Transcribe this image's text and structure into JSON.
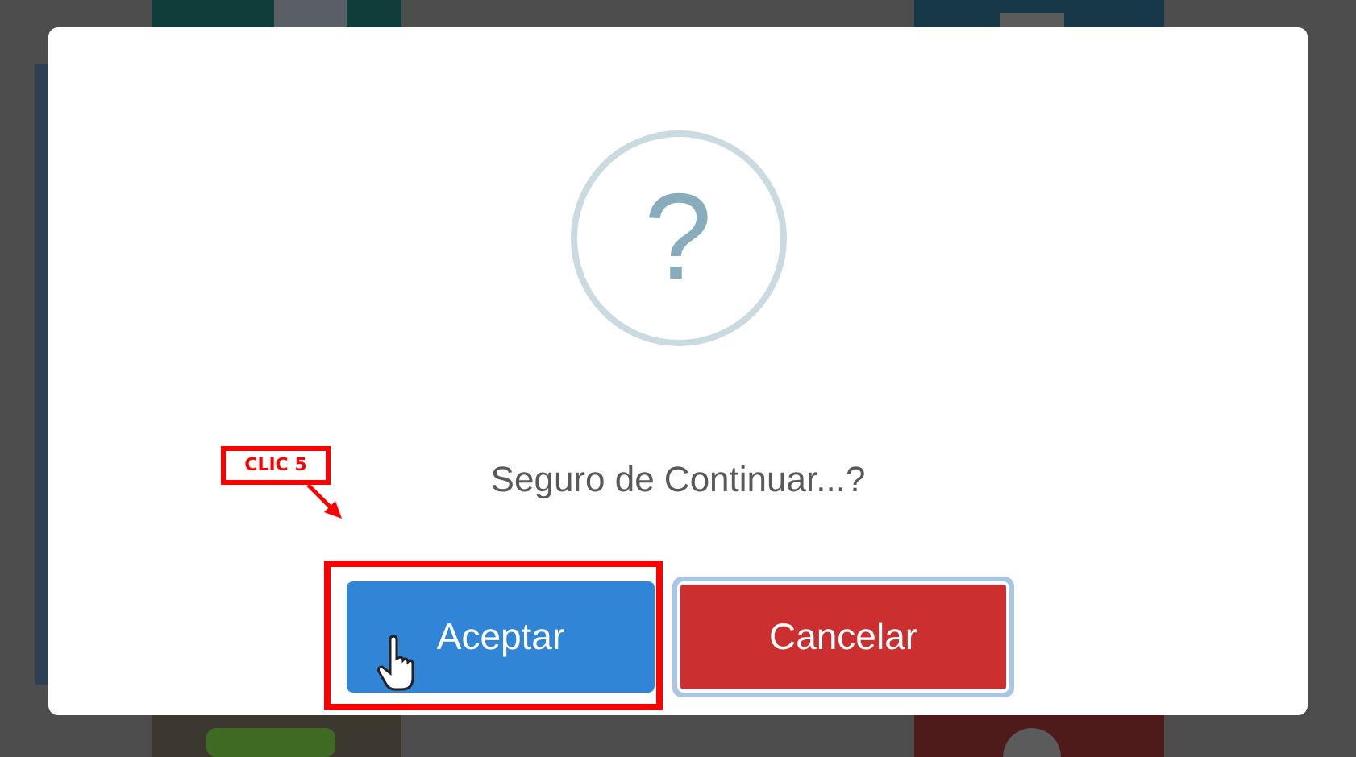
{
  "dialog": {
    "icon": "?",
    "message": "Seguro de Continuar...?",
    "buttons": [
      {
        "kind": "confirm",
        "label": "Aceptar",
        "focused": false,
        "highlighted": true
      },
      {
        "kind": "cancel",
        "label": "Cancelar",
        "focused": true,
        "highlighted": false
      }
    ]
  },
  "annotation": {
    "label": "CLIC 5"
  }
}
